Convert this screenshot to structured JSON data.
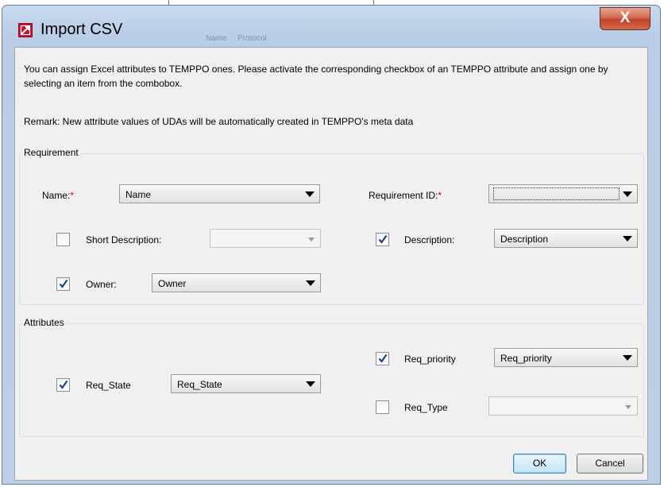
{
  "window": {
    "title": "Import CSV",
    "ghost_text_1": "Name",
    "ghost_text_2": "Protocol",
    "close_glyph": "X"
  },
  "intro_text": "You can assign Excel attributes to TEMPPO ones. Please activate the corresponding checkbox of an TEMPPO attribute and assign one by selecting an item from the combobox.",
  "remark_text": "Remark: New attribute values of UDAs will be automatically created in TEMPPO's meta data",
  "requirement": {
    "group_title": "Requirement",
    "required_marker": "*",
    "name": {
      "label": "Name:",
      "value": "Name"
    },
    "requirement_id": {
      "label": "Requirement ID:",
      "value": ""
    },
    "short_description": {
      "label": "Short Description:",
      "checked": false,
      "value": ""
    },
    "description": {
      "label": "Description:",
      "checked": true,
      "value": "Description"
    },
    "owner": {
      "label": "Owner:",
      "checked": true,
      "value": "Owner"
    }
  },
  "attributes": {
    "group_title": "Attributes",
    "req_state": {
      "label": "Req_State",
      "checked": true,
      "value": "Req_State"
    },
    "req_priority": {
      "label": "Req_priority",
      "checked": true,
      "value": "Req_priority"
    },
    "req_type": {
      "label": "Req_Type",
      "checked": false,
      "value": ""
    }
  },
  "buttons": {
    "ok": "OK",
    "cancel": "Cancel"
  },
  "icons": {
    "app": "import-csv-icon",
    "close": "close-icon",
    "checkmark": "checkmark-icon",
    "dropdown": "chevron-down-icon"
  },
  "colors": {
    "title_bar": "#bccfe6",
    "close_button": "#c0412a",
    "dialog_background": "#f0f0f0",
    "required_marker": "#d40000",
    "app_icon": "#c8102e"
  }
}
